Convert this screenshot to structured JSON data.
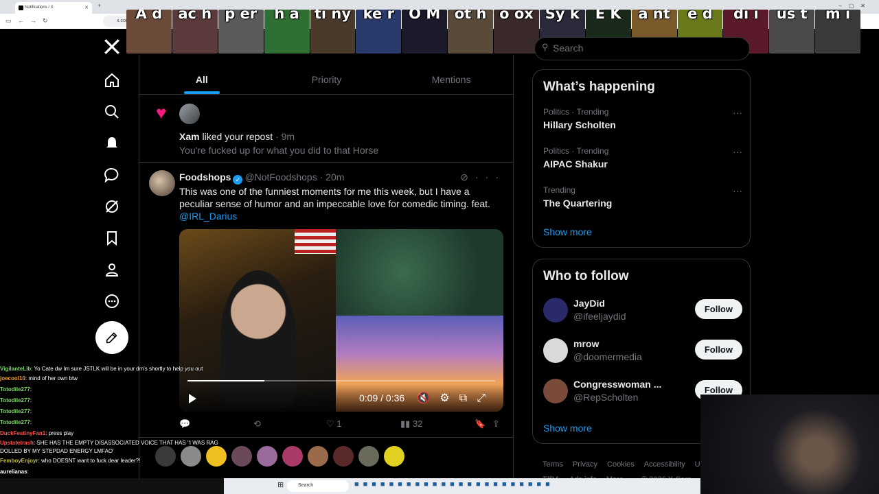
{
  "browser": {
    "tab_title": "Notifications / X",
    "url": "x.com"
  },
  "emotes": [
    {
      "text": "A d",
      "color": "#6b4a3a"
    },
    {
      "text": "ac h",
      "color": "#5a3a3a"
    },
    {
      "text": "p er",
      "color": "#5b5b5b"
    },
    {
      "text": "h a",
      "color": "#2f6f33"
    },
    {
      "text": "ti ny",
      "color": "#4a3a2a"
    },
    {
      "text": "ke r",
      "color": "#2a3a6a"
    },
    {
      "text": "O M",
      "color": "#1a1a2a"
    },
    {
      "text": "ot h",
      "color": "#5a4a3a"
    },
    {
      "text": "o ox",
      "color": "#3a2a2a"
    },
    {
      "text": "Sy k",
      "color": "#2a2a3a"
    },
    {
      "text": "E K",
      "color": "#1a2a1a"
    },
    {
      "text": "a nt",
      "color": "#7a5a2a"
    },
    {
      "text": "e d",
      "color": "#6a7a1a"
    },
    {
      "text": "di i",
      "color": "#5a1a2a"
    },
    {
      "text": "us t",
      "color": "#4a4a4a"
    },
    {
      "text": "m i",
      "color": "#3a3a3a"
    }
  ],
  "sidebar": {
    "items": [
      "home-icon",
      "explore-icon",
      "notifications-icon",
      "messages-icon",
      "grok-icon",
      "bookmarks-icon",
      "profile-icon",
      "more-icon"
    ]
  },
  "tabs": [
    "All",
    "Priority",
    "Mentions"
  ],
  "notification": {
    "liker": "Xam",
    "action": " liked your repost",
    "time": " · 9m",
    "subtitle": "You're fucked up for what you did to that Horse"
  },
  "post": {
    "name": "Foodshops",
    "handle": "@NotFoodshops",
    "time": "· 20m",
    "text": "This was one of the funniest moments for me this week, but I have a peculiar sense of humor and an impeccable love for comedic timing. feat.",
    "mention": "@IRL_Darius",
    "video_time": "0:09 / 0:36",
    "video_progress": 0.25,
    "likes": "1",
    "views": "32"
  },
  "search": {
    "placeholder": "Search"
  },
  "trends": {
    "title": "What’s happening",
    "items": [
      {
        "meta": "Politics · Trending",
        "name": "Hillary Scholten"
      },
      {
        "meta": "Politics · Trending",
        "name": "AIPAC Shakur"
      },
      {
        "meta": "Trending",
        "name": "The Quartering"
      }
    ],
    "show_more": "Show more"
  },
  "who_to_follow": {
    "title": "Who to follow",
    "users": [
      {
        "name": "JayDid",
        "handle": "@ifeeljaydid",
        "button": "Follow",
        "avatar_color": "#2a2a6a"
      },
      {
        "name": "mrow",
        "handle": "@doomermedia",
        "button": "Follow",
        "avatar_color": "#d9d9d9"
      },
      {
        "name": "Congresswoman ...",
        "handle": "@RepScholten",
        "button": "Follow",
        "avatar_color": "#7a4a3a"
      }
    ],
    "show_more": "Show more"
  },
  "footer": [
    "Terms",
    "Privacy",
    "Cookies",
    "Accessibility",
    "US TIDA",
    "Ads info",
    "More ...",
    "© 2026 X Corp."
  ],
  "chat": [
    {
      "user": "VigilanteLib",
      "color": "#7fd86b",
      "msg": ": Yo Cate dw Im sure JSTLK will be in your dm's shortly to help you out"
    },
    {
      "user": "joecool10",
      "color": "#f0a030",
      "msg": ": mind of her own btw"
    },
    {
      "user": "Totodile277",
      "color": "#7fd86b",
      "msg": ":"
    },
    {
      "user": "Totodile277",
      "color": "#7fd86b",
      "msg": ":"
    },
    {
      "user": "Totodile277",
      "color": "#7fd86b",
      "msg": ":"
    },
    {
      "user": "Totodile277",
      "color": "#7fd86b",
      "msg": ":"
    },
    {
      "user": "DuckFestinyFan1",
      "color": "#ff5050",
      "msg": ": press play"
    },
    {
      "user": "Upstatetrash",
      "color": "#ff5050",
      "msg": ": SHE HAS THE EMPTY DISASSOCIATED VOICE THAT HAS \"I WAS RAG DOLLED BY MY STEPDAD ENERGY LMFAO'"
    },
    {
      "user": "FemboyEnjoyr",
      "color": "#c0c040",
      "msg": ": who DOESNT want to fuck dear leader?!"
    },
    {
      "user": "aurelianas",
      "color": "#ffffff",
      "msg": ":"
    }
  ],
  "bottom_emote_colors": [
    "#3a3a3a",
    "#8a8a8a",
    "#f0c020",
    "#6a4a5a",
    "#9a6a9a",
    "#aa3a6a",
    "#9a6a4a",
    "#5a2a2a",
    "#6a6a5a",
    "#e0d020"
  ],
  "taskbar": {
    "search_label": "Search"
  }
}
